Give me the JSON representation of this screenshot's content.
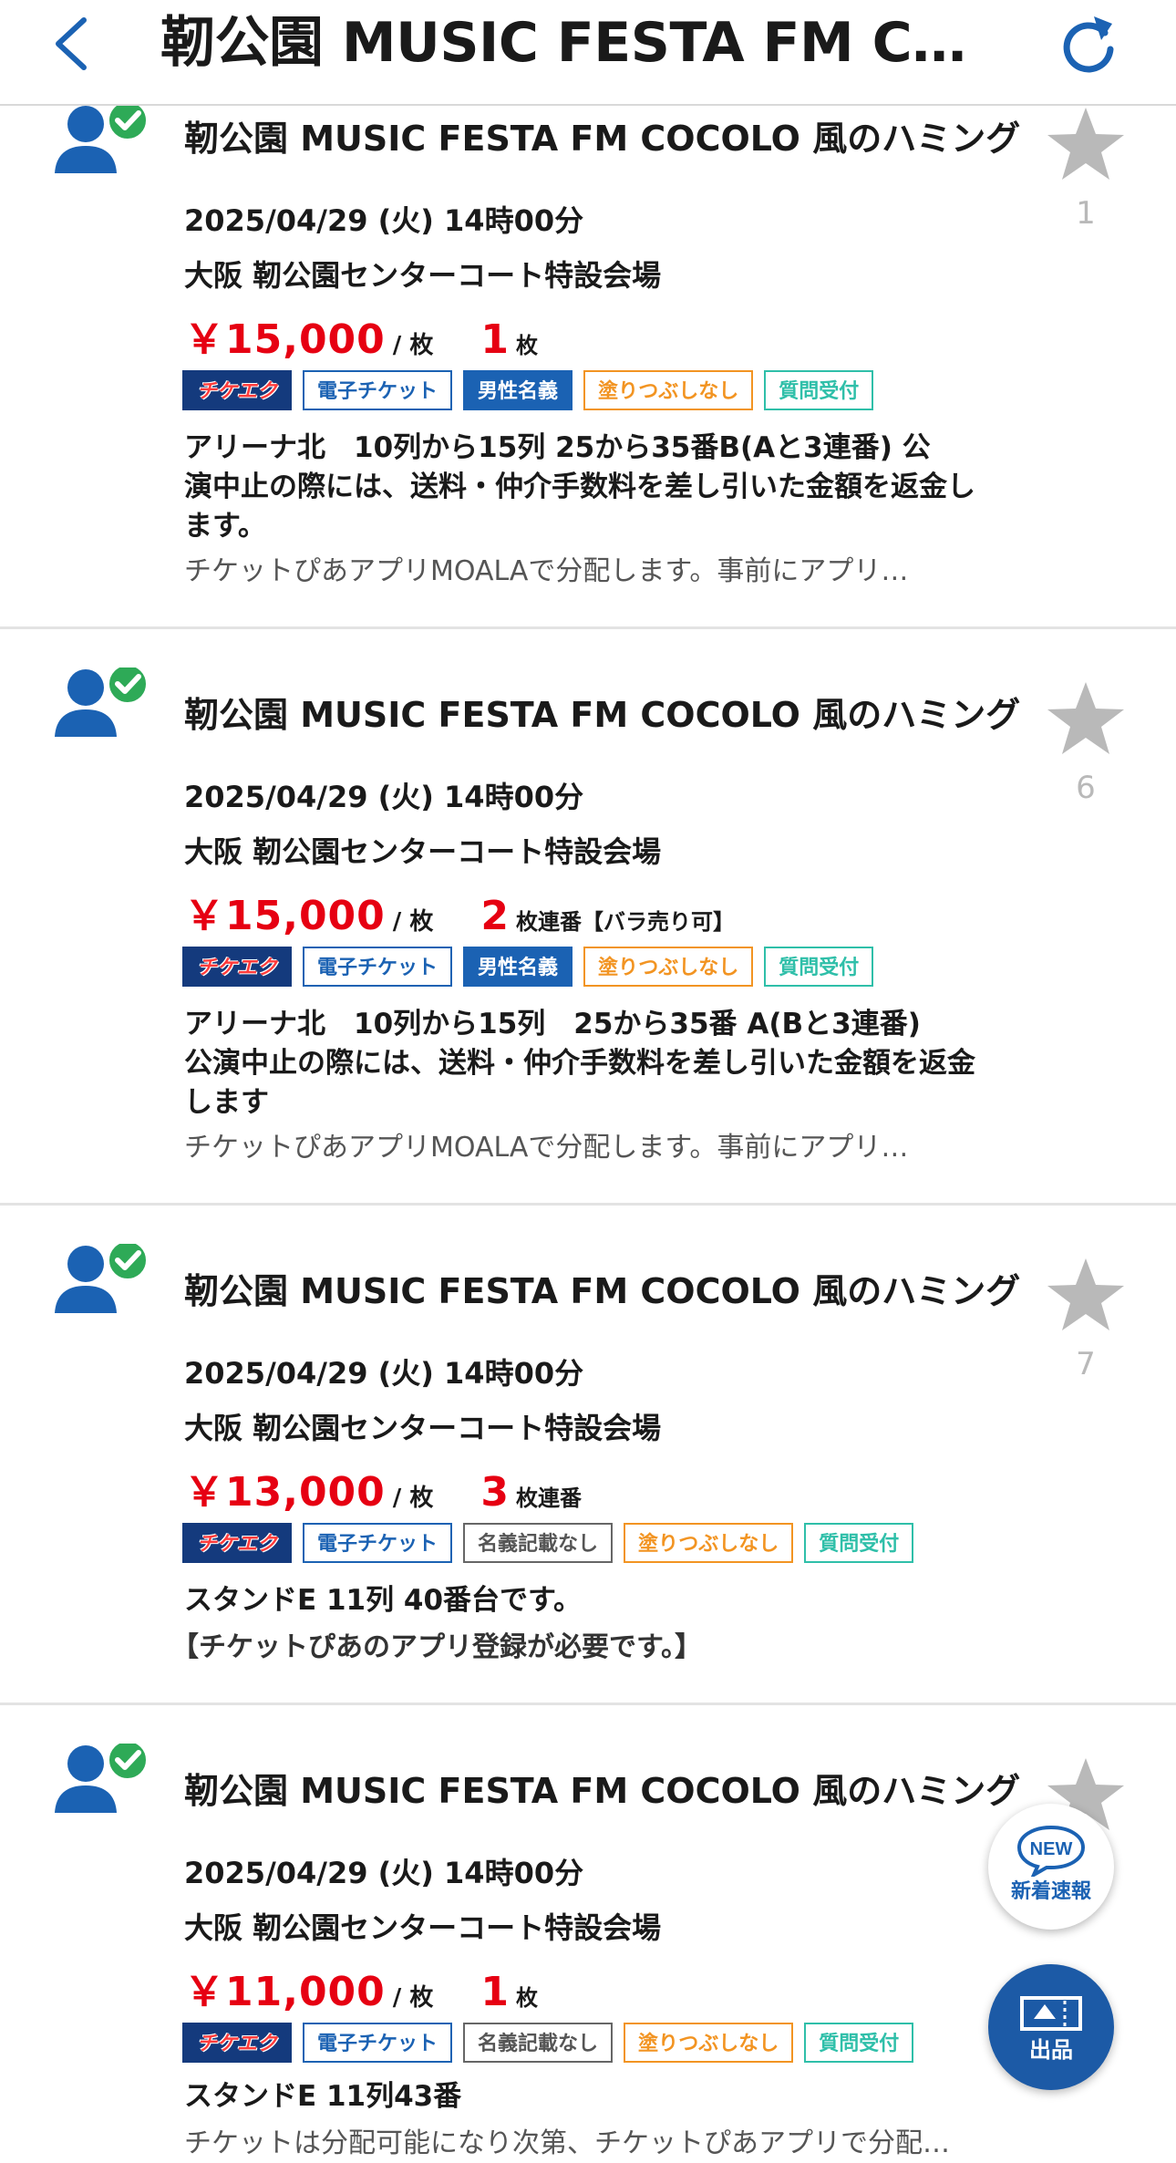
{
  "header": {
    "title": "靭公園 MUSIC FESTA FM COC...",
    "back_icon": "chevron-left-icon",
    "reload_icon": "reload-icon"
  },
  "colors": {
    "accent": "#1b62b3",
    "price": "#e60012",
    "chiketeku_bg": "#143a7d",
    "orange": "#f29422",
    "teal": "#2fbfa9"
  },
  "listings": [
    {
      "title": "靭公園 MUSIC FESTA FM COCOLO 風のハミング",
      "favorites": "1",
      "date": "2025/04/29 (火) 14時00分",
      "venue": "大阪 靭公園センターコート特設会場",
      "price": "￥15,000",
      "unit": "/ 枚",
      "qty": "1",
      "qty_note": "枚",
      "tags": [
        "チケエク",
        "電子チケット",
        "男性名義",
        "塗りつぶしなし",
        "質問受付"
      ],
      "desc_lines": [
        " アリーナ北　10列から15列 25から35番B(Aと3連番) 公",
        "演中止の際には、送料・仲介手数料を差し引いた金額を返金し",
        "ます。"
      ],
      "note": "チケットぴあアプリMOALAで分配します。事前にアプリ…"
    },
    {
      "title": "靭公園 MUSIC FESTA FM COCOLO 風のハミング",
      "favorites": "6",
      "date": "2025/04/29 (火) 14時00分",
      "venue": "大阪 靭公園センターコート特設会場",
      "price": "￥15,000",
      "unit": "/ 枚",
      "qty": "2",
      "qty_note": "枚連番【バラ売り可】",
      "tags": [
        "チケエク",
        "電子チケット",
        "男性名義",
        "塗りつぶしなし",
        "質問受付"
      ],
      "desc_lines": [
        " アリーナ北　10列から15列　25から35番 A(Bと3連番)",
        "公演中止の際には、送料・仲介手数料を差し引いた金額を返金",
        "します"
      ],
      "note": "チケットぴあアプリMOALAで分配します。事前にアプリ…"
    },
    {
      "title": "靭公園 MUSIC FESTA FM COCOLO 風のハミング",
      "favorites": "7",
      "date": "2025/04/29 (火) 14時00分",
      "venue": "大阪 靭公園センターコート特設会場",
      "price": "￥13,000",
      "unit": "/ 枚",
      "qty": "3",
      "qty_note": "枚連番",
      "tags": [
        "チケエク",
        "電子チケット",
        "名義記載なし",
        "塗りつぶしなし",
        "質問受付"
      ],
      "desc_lines": [
        " スタンドE 11列 40番台です。"
      ],
      "note": "【チケットぴあのアプリ登録が必要です。】"
    },
    {
      "title": "靭公園 MUSIC FESTA FM COCOLO 風のハミング",
      "favorites": "",
      "date": "2025/04/29 (火) 14時00分",
      "venue": "大阪 靭公園センターコート特設会場",
      "price": "￥11,000",
      "unit": "/ 枚",
      "qty": "1",
      "qty_note": "枚",
      "tags": [
        "チケエク",
        "電子チケット",
        "名義記載なし",
        "塗りつぶしなし",
        "質問受付"
      ],
      "desc_lines": [
        " スタンドE 11列43番"
      ],
      "note": "チケットは分配可能になり次第、チケットぴあアプリで分配…"
    }
  ],
  "fab": {
    "new_badge": "NEW",
    "new_label": "新着速報",
    "sell_label": "出品"
  }
}
